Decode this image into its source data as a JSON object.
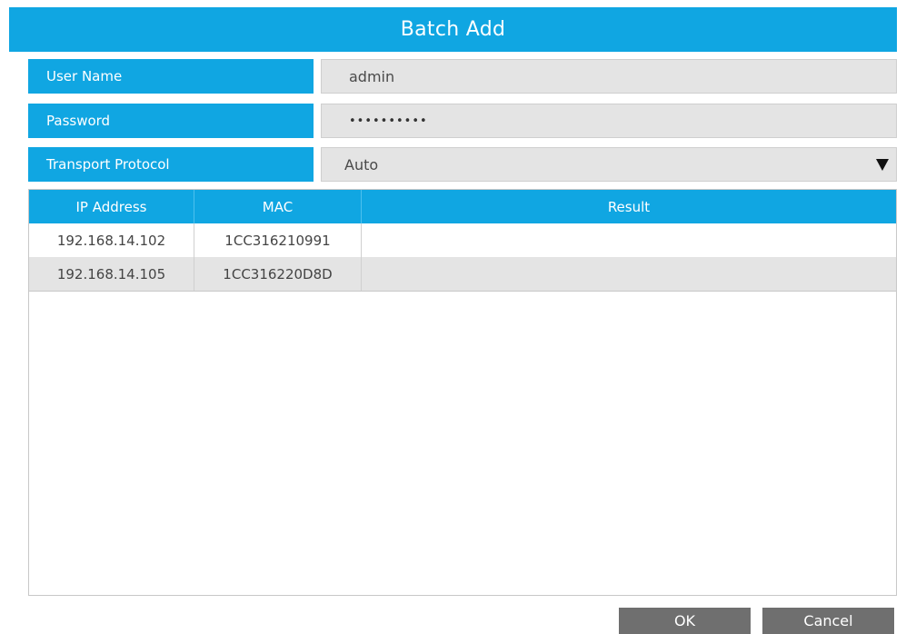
{
  "dialog": {
    "title": "Batch Add"
  },
  "form": {
    "user_name": {
      "label": "User Name",
      "value": "admin"
    },
    "password": {
      "label": "Password",
      "value": "••••••••••"
    },
    "transport_protocol": {
      "label": "Transport Protocol",
      "value": "Auto"
    }
  },
  "table": {
    "headers": [
      "IP Address",
      "MAC",
      "Result"
    ],
    "rows": [
      {
        "ip": "192.168.14.102",
        "mac": "1CC316210991",
        "result": ""
      },
      {
        "ip": "192.168.14.105",
        "mac": "1CC316220D8D",
        "result": ""
      }
    ]
  },
  "buttons": {
    "ok": "OK",
    "cancel": "Cancel"
  },
  "colors": {
    "accent": "#10a6e2",
    "button": "#6f6f6f",
    "field_bg": "#e4e4e4"
  },
  "icons": {
    "dropdown": "caret-down-icon"
  }
}
